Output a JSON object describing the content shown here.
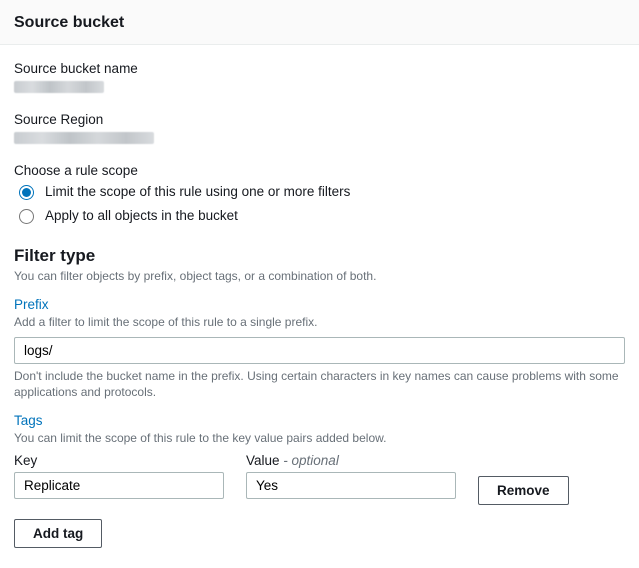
{
  "header": {
    "title": "Source bucket"
  },
  "source_bucket_name": {
    "label": "Source bucket name"
  },
  "source_region": {
    "label": "Source Region"
  },
  "rule_scope": {
    "label": "Choose a rule scope",
    "option_filtered": "Limit the scope of this rule using one or more filters",
    "option_all": "Apply to all objects in the bucket",
    "selected": "filtered"
  },
  "filter_type": {
    "heading": "Filter type",
    "helper": "You can filter objects by prefix, object tags, or a combination of both."
  },
  "prefix": {
    "label": "Prefix",
    "helper": "Add a filter to limit the scope of this rule to a single prefix.",
    "value": "logs/",
    "hint": "Don't include the bucket name in the prefix. Using certain characters in key names can cause problems with some applications and protocols."
  },
  "tags": {
    "label": "Tags",
    "helper": "You can limit the scope of this rule to the key value pairs added below.",
    "key_header": "Key",
    "value_header": "Value",
    "value_optional": " - optional",
    "rows": [
      {
        "key": "Replicate",
        "value": "Yes"
      }
    ],
    "remove_label": "Remove",
    "add_label": "Add tag"
  }
}
